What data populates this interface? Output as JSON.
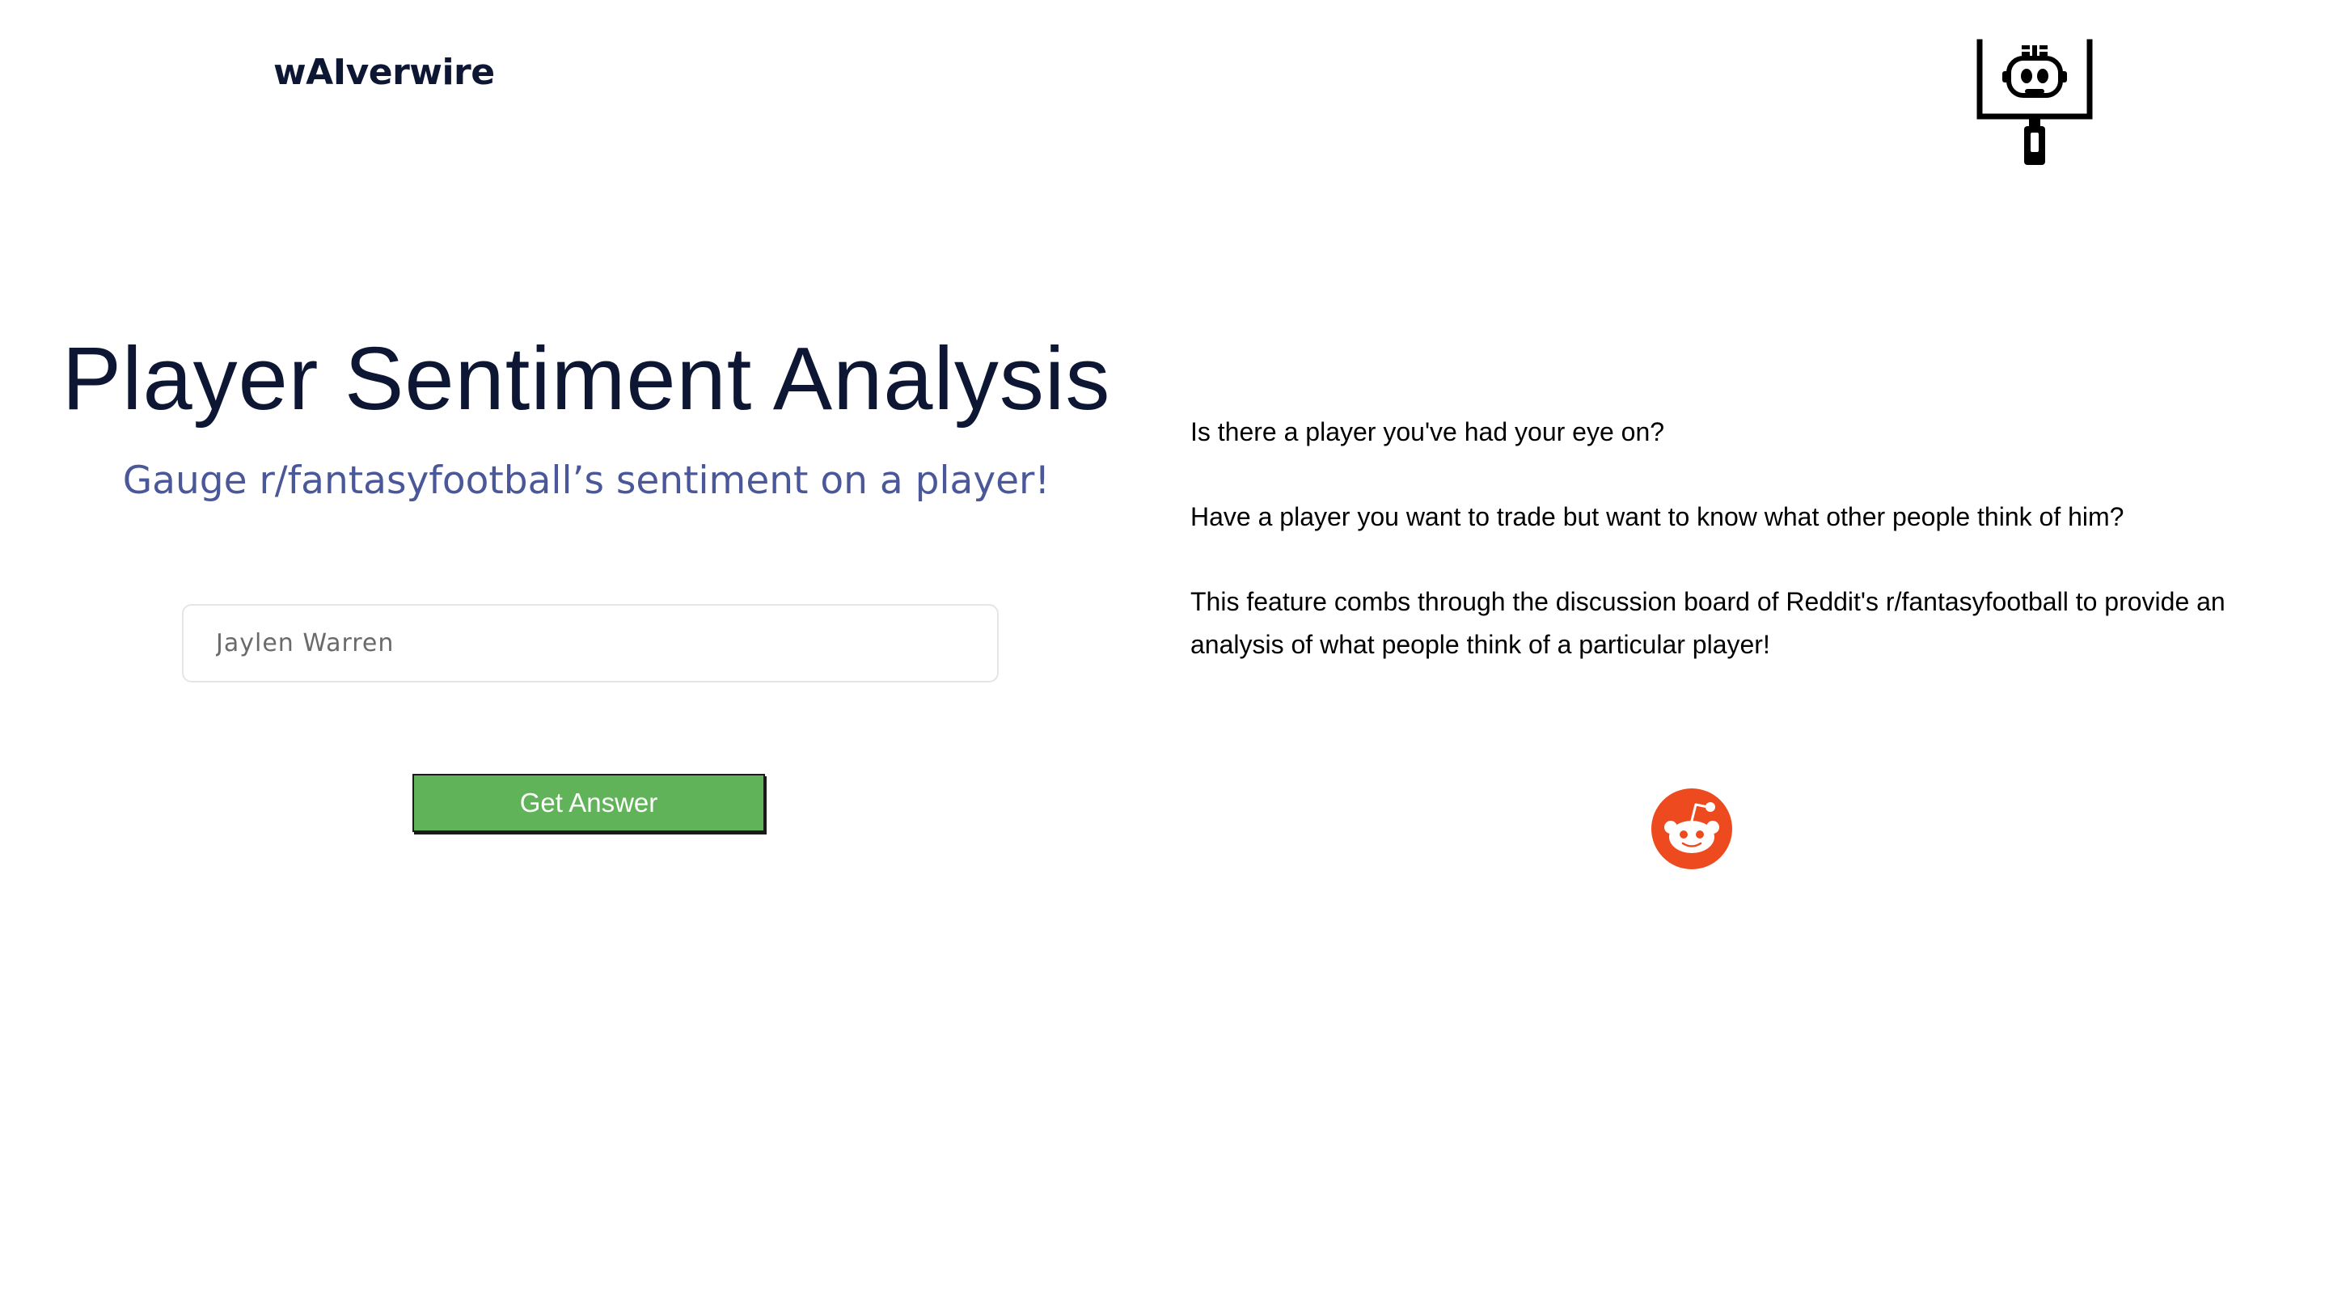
{
  "header": {
    "brand": "wAIverwire"
  },
  "hero": {
    "title": "Player Sentiment Analysis",
    "subtitle": "Gauge r/fantasyfootball’s sentiment on a player!"
  },
  "search": {
    "placeholder": "Jaylen Warren",
    "value": ""
  },
  "actions": {
    "submit_label": "Get Answer"
  },
  "description": {
    "paragraphs": [
      "Is there a player you've had your eye on?",
      "Have a player you want to trade but want to know what other people think of him?",
      "This feature combs through the discussion board of Reddit's r/fantasyfootball to provide an analysis of what people think of a particular player!"
    ]
  },
  "icons": {
    "logo": "goalpost-robot-icon",
    "source": "reddit-icon"
  },
  "colors": {
    "brand_text": "#0d1633",
    "subtitle": "#4a5899",
    "button_bg": "#61b35a",
    "reddit": "#ee4a1f"
  }
}
